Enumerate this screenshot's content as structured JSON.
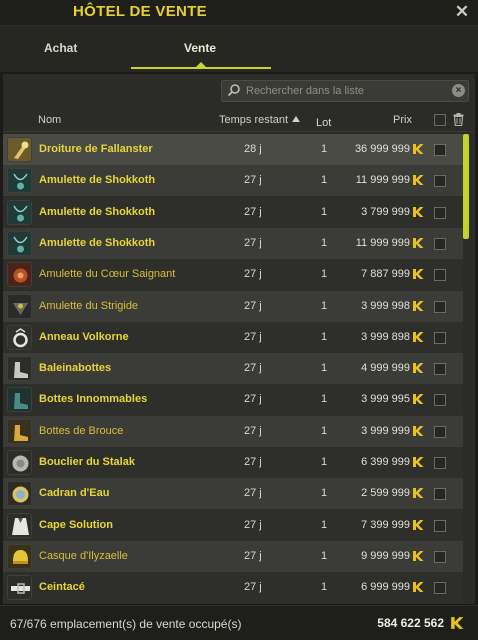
{
  "window": {
    "title": "HÔTEL DE VENTE",
    "close_icon": "close-icon"
  },
  "tabs": [
    {
      "label": "Achat",
      "active": false
    },
    {
      "label": "Vente",
      "active": true
    }
  ],
  "search": {
    "placeholder": "Rechercher dans la liste",
    "value": ""
  },
  "table": {
    "headers": {
      "name": "Nom",
      "time": "Temps restant",
      "lot": "Lot",
      "price": "Prix"
    },
    "sort": {
      "column": "time",
      "direction": "ascending"
    },
    "rows": [
      {
        "icon": "scepter-icon",
        "name": "Droiture de Fallanster",
        "time": "28 j",
        "lot": "1",
        "price": "36 999 999",
        "rarity": "bold"
      },
      {
        "icon": "amulet-icon",
        "name": "Amulette de Shokkoth",
        "time": "27 j",
        "lot": "1",
        "price": "11 999 999",
        "rarity": "bold"
      },
      {
        "icon": "amulet-icon",
        "name": "Amulette de Shokkoth",
        "time": "27 j",
        "lot": "1",
        "price": "3 799 999",
        "rarity": "bold"
      },
      {
        "icon": "amulet-icon",
        "name": "Amulette de Shokkoth",
        "time": "27 j",
        "lot": "1",
        "price": "11 999 999",
        "rarity": "bold"
      },
      {
        "icon": "amulet-red-icon",
        "name": "Amulette du Cœur Saignant",
        "time": "27 j",
        "lot": "1",
        "price": "7 887 999",
        "rarity": "normal"
      },
      {
        "icon": "amulet-dark-icon",
        "name": "Amulette du Strigide",
        "time": "27 j",
        "lot": "1",
        "price": "3 999 998",
        "rarity": "normal"
      },
      {
        "icon": "ring-icon",
        "name": "Anneau Volkorne",
        "time": "27 j",
        "lot": "1",
        "price": "3 999 898",
        "rarity": "bold"
      },
      {
        "icon": "boots-icon",
        "name": "Baleinabottes",
        "time": "27 j",
        "lot": "1",
        "price": "4 999 999",
        "rarity": "bold"
      },
      {
        "icon": "boots-teal-icon",
        "name": "Bottes Innommables",
        "time": "27 j",
        "lot": "1",
        "price": "3 999 995",
        "rarity": "bold"
      },
      {
        "icon": "boots-gold-icon",
        "name": "Bottes de Brouce",
        "time": "27 j",
        "lot": "1",
        "price": "3 999 999",
        "rarity": "normal"
      },
      {
        "icon": "shield-icon",
        "name": "Bouclier du Stalak",
        "time": "27 j",
        "lot": "1",
        "price": "6 399 999",
        "rarity": "bold"
      },
      {
        "icon": "dial-icon",
        "name": "Cadran d'Eau",
        "time": "27 j",
        "lot": "1",
        "price": "2 599 999",
        "rarity": "bold"
      },
      {
        "icon": "cape-icon",
        "name": "Cape Solution",
        "time": "27 j",
        "lot": "1",
        "price": "7 399 999",
        "rarity": "bold"
      },
      {
        "icon": "helmet-icon",
        "name": "Casque d'Ilyzaelle",
        "time": "27 j",
        "lot": "1",
        "price": "9 999 999",
        "rarity": "normal"
      },
      {
        "icon": "belt-icon",
        "name": "Ceintacé",
        "time": "27 j",
        "lot": "1",
        "price": "6 999 999",
        "rarity": "bold"
      }
    ]
  },
  "footer": {
    "slots_text": "67/676 emplacement(s) de vente occupé(s)",
    "total": "584 622 562"
  },
  "colors": {
    "accent": "#c9d52a",
    "item_name": "#e7d63a",
    "kama": "#e8c21e"
  }
}
